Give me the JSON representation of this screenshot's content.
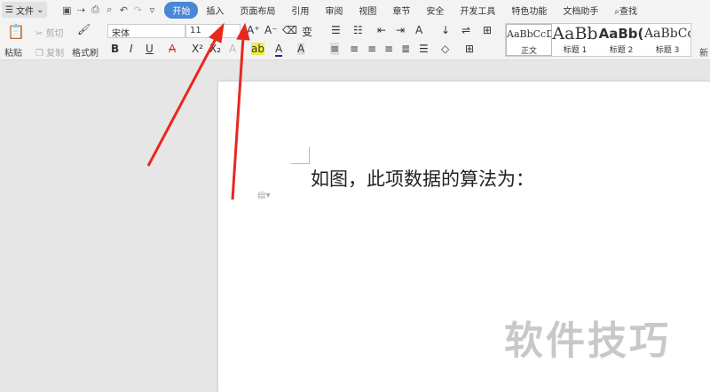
{
  "menu": {
    "file": "文件",
    "tabs": [
      "开始",
      "插入",
      "页面布局",
      "引用",
      "审阅",
      "视图",
      "章节",
      "安全",
      "开发工具",
      "特色功能",
      "文档助手"
    ],
    "search": "查找"
  },
  "ribbon": {
    "paste": "粘贴",
    "cut": "剪切",
    "copy": "复制",
    "format_painter": "格式刷",
    "font": "宋体",
    "size": "11",
    "styles": [
      {
        "preview": "AaBbCcDd",
        "label": "正文"
      },
      {
        "preview": "AaBb",
        "label": "标题 1"
      },
      {
        "preview": "AaBb(",
        "label": "标题 2"
      },
      {
        "preview": "AaBbCc",
        "label": "标题 3"
      }
    ],
    "new_style": "新"
  },
  "document": {
    "text": "如图，此项数据的算法为："
  },
  "watermark": "软件技巧",
  "colors": {
    "accent": "#4a86d6",
    "arrow": "#e8281e"
  }
}
